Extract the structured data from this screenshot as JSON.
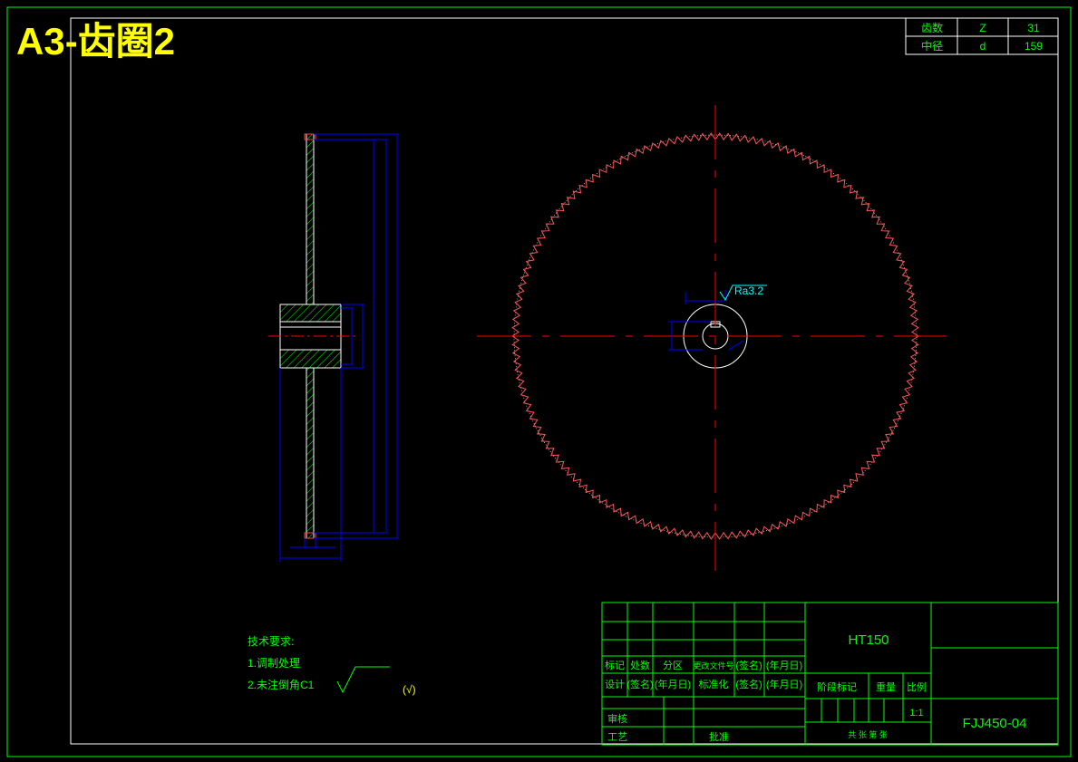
{
  "title": "A3-齿圈2",
  "param_table": {
    "rows": [
      {
        "name": "齿数",
        "symbol": "Z",
        "value": "31"
      },
      {
        "name": "中径",
        "symbol": "d",
        "value": "159"
      }
    ]
  },
  "roughness_label": "Ra3.2",
  "tech_req": {
    "heading": "技术要求:",
    "items": [
      "1.调制处理",
      "2.未注倒角C1"
    ],
    "general_mark": "(√)"
  },
  "title_block": {
    "material": "HT150",
    "drawing_number": "FJJ450-04",
    "scale": "1:1",
    "row_labels": [
      "标记",
      "处数",
      "分区",
      "更改文件号",
      "(签名)",
      "(年月日)"
    ],
    "design_row": [
      "设计",
      "(签名)",
      "(年月日)",
      "标准化",
      "(签名)",
      "(年月日)"
    ],
    "stage_label": "阶段标记",
    "weight_label": "重量",
    "scale_label": "比例",
    "review_label": "审核",
    "process_label": "工艺",
    "approve_label": "批准",
    "sheets_label": "共 张  第 张"
  },
  "colors": {
    "frame": "#00ff00",
    "title": "#ffff00",
    "dim": "#0000ff",
    "center": "#ff0000",
    "outline": "#ffffff",
    "hatch": "#00ff00",
    "text": "#00ff00",
    "annot": "#00ffff"
  }
}
